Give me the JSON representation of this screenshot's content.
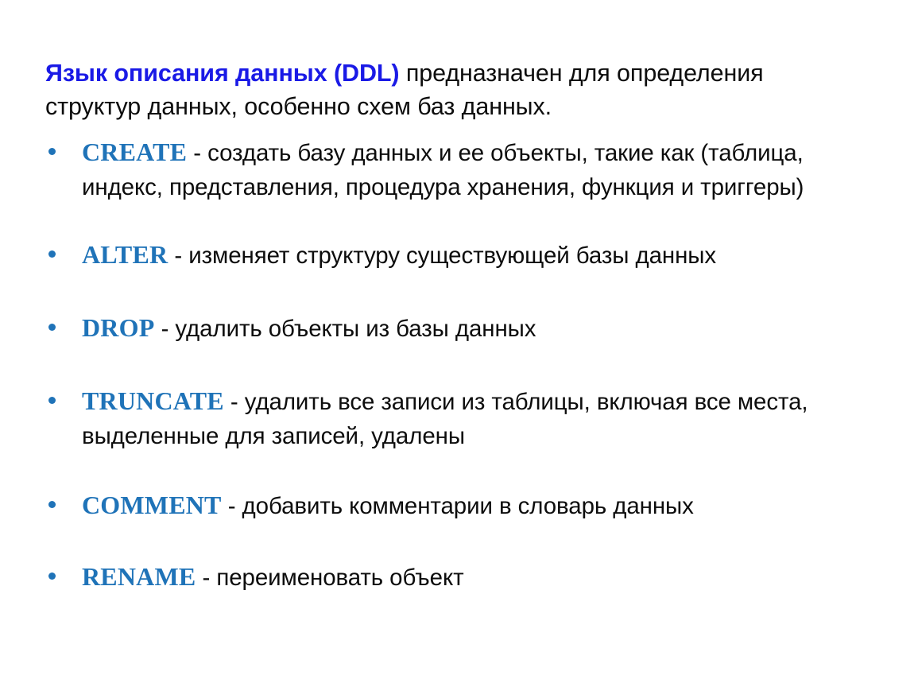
{
  "slide": {
    "intro": {
      "highlight": "Язык описания данных (DDL)",
      "rest": " предназначен для определения структур данных, особенно схем баз данных."
    },
    "bullets": [
      {
        "keyword": "CREATE",
        "description": " - создать базу данных и ее объекты, такие как (таблица, индекс, представления, процедура хранения, функция и триггеры)"
      },
      {
        "keyword": "ALTER",
        "description": " - изменяет структуру существующей базы данных"
      },
      {
        "keyword": "DROP",
        "description": " - удалить объекты из базы данных"
      },
      {
        "keyword": "TRUNCATE",
        "description": " - удалить все записи из таблицы, включая все места, выделенные для записей, удалены"
      },
      {
        "keyword": "COMMENT",
        "description": " - добавить комментарии в словарь данных"
      },
      {
        "keyword": "RENAME",
        "description": " - переименовать объект"
      }
    ],
    "colors": {
      "heading_blue": "#1a1ae6",
      "keyword_blue": "#1f73b8",
      "body_black": "#0d0d0d",
      "background": "#ffffff"
    }
  }
}
